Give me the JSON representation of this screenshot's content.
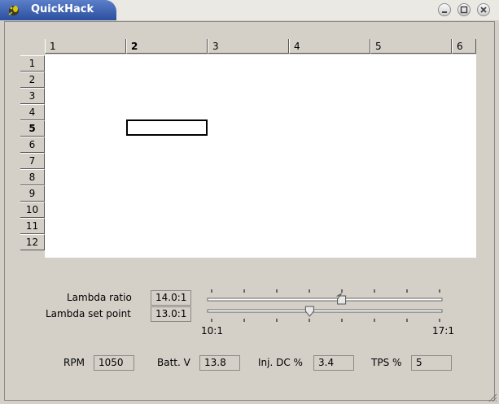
{
  "window": {
    "title": "QuickHack",
    "icon": "gecko-icon"
  },
  "grid": {
    "columns": [
      "1",
      "2",
      "3",
      "4",
      "5",
      "6"
    ],
    "rows": [
      "1",
      "2",
      "3",
      "4",
      "5",
      "6",
      "7",
      "8",
      "9",
      "10",
      "11",
      "12"
    ],
    "active_column": "2",
    "active_row": "5"
  },
  "lambda": {
    "ratio_label": "Lambda ratio",
    "ratio_value": "14.0:1",
    "setpoint_label": "Lambda set point",
    "setpoint_value": "13.0:1",
    "scale_min": "10:1",
    "scale_max": "17:1",
    "ratio_level": 0.57,
    "setpoint_level": 0.43
  },
  "status": {
    "rpm_label": "RPM",
    "rpm_value": "1050",
    "batt_label": "Batt. V",
    "batt_value": "13.8",
    "inj_label": "Inj. DC %",
    "inj_value": "3.4",
    "tps_label": "TPS %",
    "tps_value": "5"
  }
}
